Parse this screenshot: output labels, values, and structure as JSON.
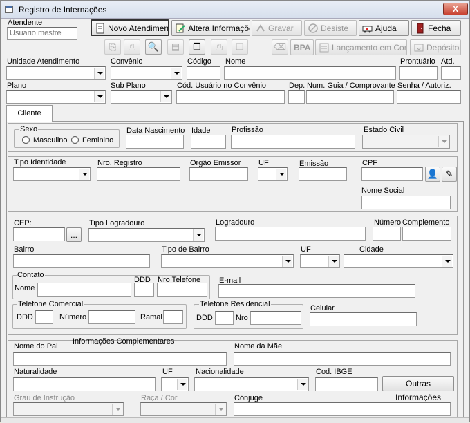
{
  "window": {
    "title": "Registro de Internações",
    "close_label": "X"
  },
  "atendente": {
    "label": "Atendente",
    "value": "Usuario mestre"
  },
  "toolbar": {
    "novo": "Novo Atendimento",
    "altera": "Altera Informações",
    "gravar": "Gravar",
    "desiste": "Desiste",
    "ajuda": "Ajuda",
    "fecha": "Fecha",
    "bpa": "BPA",
    "lancamento": "Lançamento em Conta",
    "deposito": "Depósito"
  },
  "header_fields": {
    "unidade": "Unidade Atendimento",
    "convenio": "Convênio",
    "codigo": "Código",
    "nome": "Nome",
    "prontuario": "Prontuário",
    "atd": "Atd.",
    "plano": "Plano",
    "sub_plano": "Sub Plano",
    "cod_usuario": "Cód. Usuário no Convênio",
    "dep": "Dep.",
    "num_guia": "Num. Guia / Comprovante",
    "senha": "Senha / Autoriz."
  },
  "tabs": [
    {
      "label": "Cliente"
    }
  ],
  "pessoal": {
    "sexo": "Sexo",
    "masculino": "Masculino",
    "feminino": "Feminino",
    "data_nascimento": "Data Nascimento",
    "idade": "Idade",
    "profissao": "Profissão",
    "estado_civil": "Estado Civil"
  },
  "identidade": {
    "tipo": "Tipo Identidade",
    "registro": "Nro. Registro",
    "orgao": "Orgão Emissor",
    "uf": "UF",
    "emissao": "Emissão",
    "cpf": "CPF",
    "nome_social": "Nome Social"
  },
  "endereco": {
    "cep": "CEP:",
    "cep_btn": "...",
    "tipo_logradouro": "Tipo Logradouro",
    "logradouro": "Logradouro",
    "numero": "Número",
    "complemento": "Complemento",
    "bairro": "Bairro",
    "tipo_bairro": "Tipo de Bairro",
    "uf": "UF",
    "cidade": "Cidade",
    "contato": "Contato",
    "contato_nome": "Nome",
    "ddd": "DDD",
    "nro_telefone": "Nro Telefone",
    "email": "E-mail",
    "tel_comercial": "Telefone Comercial",
    "tc_ddd": "DDD",
    "tc_numero": "Número",
    "tc_ramal": "Ramal",
    "tel_residencial": "Telefone Residencial",
    "tr_ddd": "DDD",
    "tr_nro": "Nro",
    "celular": "Celular"
  },
  "complementares": {
    "titulo": "Informações Complementares",
    "nome_pai": "Nome do Pai",
    "nome_mae": "Nome da Mãe",
    "naturalidade": "Naturalidade",
    "uf": "UF",
    "nacionalidade": "Nacionalidade",
    "cod_ibge": "Cod. IBGE",
    "outras": "Outras Informações",
    "grau_instrucao": "Grau de Instrução",
    "raca_cor": "Raça / Cor",
    "conjuge": "Cônjuge"
  }
}
